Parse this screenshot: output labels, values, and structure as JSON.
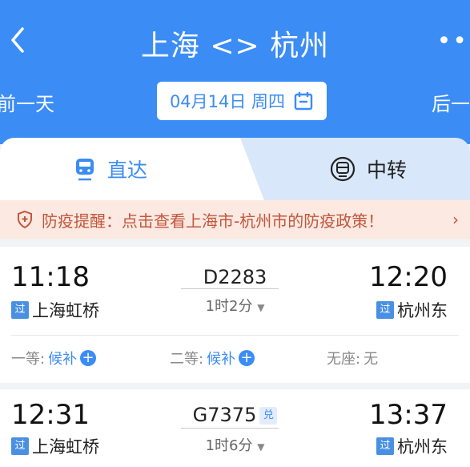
{
  "header": {
    "title": "上海 <> 杭州",
    "prev_day": "前一天",
    "next_day": "后一天",
    "date": "04月14日 周四"
  },
  "tabs": {
    "direct": "直达",
    "transfer": "中转"
  },
  "notice": {
    "text": "防疫提醒：点击查看上海市-杭州市的防疫政策！",
    "chevron": "›"
  },
  "trains": [
    {
      "depart_time": "11:18",
      "depart_station": "上海虹桥",
      "train_no": "D2283",
      "duration": "1时2分",
      "arrive_time": "12:20",
      "arrive_station": "杭州东",
      "pass_badge": "过",
      "seats": [
        {
          "label": "一等:",
          "status": "候补"
        },
        {
          "label": "二等:",
          "status": "候补"
        },
        {
          "label": "无座:",
          "status": "无"
        }
      ]
    },
    {
      "depart_time": "12:31",
      "depart_station": "上海虹桥",
      "train_no": "G7375",
      "dui": "兑",
      "duration": "1时6分",
      "arrive_time": "13:37",
      "arrive_station": "杭州东",
      "pass_badge": "过"
    }
  ],
  "colors": {
    "brand": "#3b8cf5",
    "notice_bg": "#fbe9e2",
    "notice_text": "#c2563b"
  }
}
